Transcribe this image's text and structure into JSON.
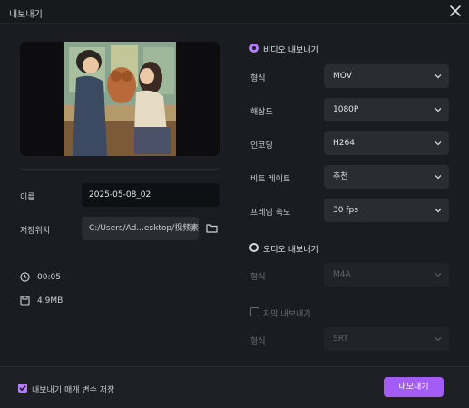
{
  "window": {
    "title": "내보내기"
  },
  "left": {
    "name_label": "이름",
    "name_value": "2025-05-08_02",
    "location_label": "저장위치",
    "location_value": "C:/Users/Ad...esktop/视频素材",
    "duration": "00:05",
    "size": "4.9MB"
  },
  "video": {
    "title": "비디오 내보내기",
    "rows": [
      {
        "label": "형식",
        "value": "MOV"
      },
      {
        "label": "해상도",
        "value": "1080P"
      },
      {
        "label": "인코딩",
        "value": "H264"
      },
      {
        "label": "비트 레이트",
        "value": "추천"
      },
      {
        "label": "프레임 속도",
        "value": "30  fps"
      }
    ]
  },
  "audio": {
    "title": "오디오 내보내기",
    "format_label": "형식",
    "format_value": "M4A"
  },
  "subtitle": {
    "title": "자막 내보내기",
    "format_label": "형식",
    "format_value": "SRT"
  },
  "footer": {
    "save_params_label": "내보내기 매개 변수 저장",
    "export_label": "내보내기"
  },
  "colors": {
    "accent": "#a35cf5",
    "radio": "#b57cff"
  },
  "icons": [
    "close-icon",
    "folder-icon",
    "clock-icon",
    "file-size-icon",
    "chevron-down-icon",
    "check-icon"
  ]
}
